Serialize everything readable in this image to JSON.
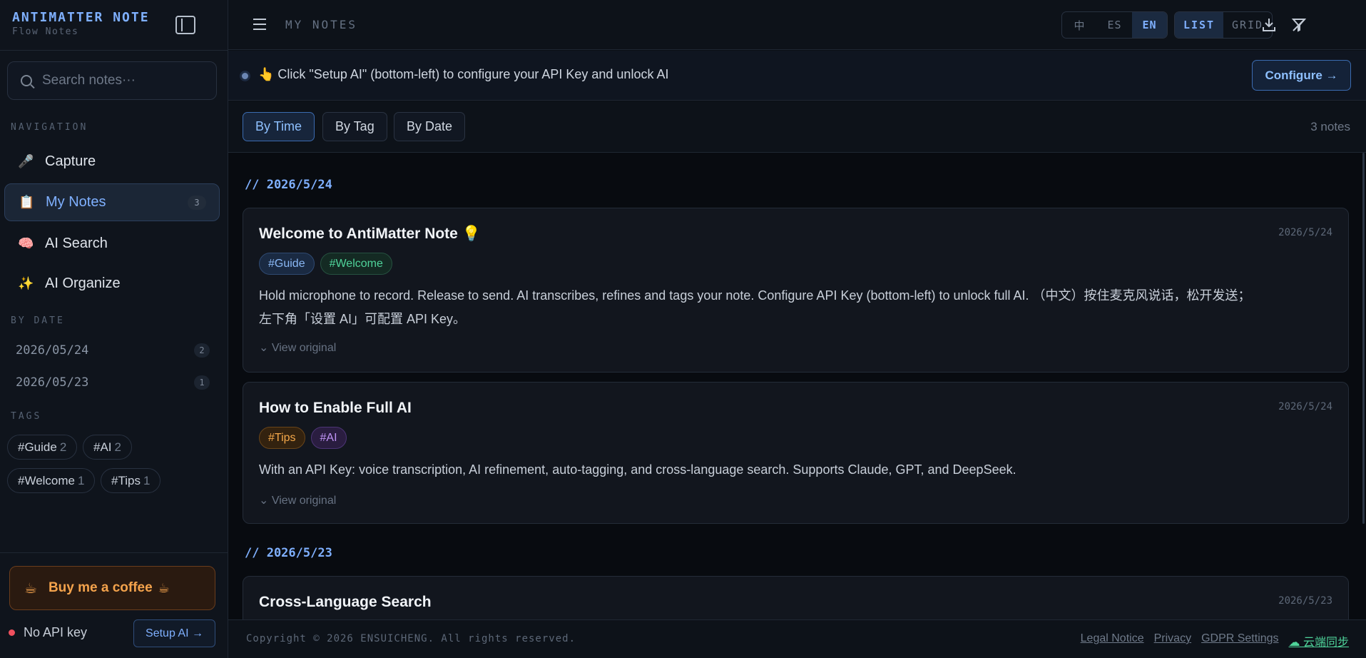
{
  "brand": {
    "title": "ANTIMATTER NOTE",
    "subtitle": "Flow Notes"
  },
  "search": {
    "placeholder": "Search notes···"
  },
  "sidebar": {
    "nav_label": "NAVIGATION",
    "nav": [
      {
        "label": "Capture",
        "icon": "🎤"
      },
      {
        "label": "My Notes",
        "icon": "📋",
        "count": "3"
      },
      {
        "label": "AI Search",
        "icon": "🧠"
      },
      {
        "label": "AI Organize",
        "icon": "✨"
      }
    ],
    "date_label": "BY DATE",
    "dates": [
      {
        "label": "2026/05/24",
        "count": "2"
      },
      {
        "label": "2026/05/23",
        "count": "1"
      }
    ],
    "tags_label": "TAGS",
    "tags": [
      {
        "label": "#Guide",
        "count": "2"
      },
      {
        "label": "#AI",
        "count": "2"
      },
      {
        "label": "#Welcome",
        "count": "1"
      },
      {
        "label": "#Tips",
        "count": "1"
      }
    ],
    "coffee": {
      "label": "Buy me a coffee",
      "icon": "☕"
    },
    "api_status": "No API key",
    "setup_label": "Setup AI →"
  },
  "topbar": {
    "title": "MY NOTES",
    "languages": [
      "中",
      "ES",
      "EN"
    ],
    "active_language": "EN",
    "views": [
      "LIST",
      "GRID"
    ],
    "active_view": "LIST"
  },
  "banner": {
    "text": "👆 Click \"Setup AI\" (bottom-left) to configure your API Key and unlock AI",
    "button": "Configure →"
  },
  "filters": {
    "sort": [
      "By Time",
      "By Tag",
      "By Date"
    ],
    "active": "By Time",
    "count": "3 notes"
  },
  "groups": [
    {
      "heading": "// 2026/5/24"
    },
    {
      "heading": "// 2026/5/23"
    }
  ],
  "notes": [
    {
      "title": "Welcome to AntiMatter Note 💡",
      "date": "2026/5/24",
      "tags": [
        "#Guide",
        "#Welcome"
      ],
      "body_line1": "Hold microphone to record. Release to send. AI transcribes, refines and tags your note. Configure API Key (bottom-left) to unlock full AI. （中文）按住麦克风说话，松开发送；",
      "body_line2": "左下角「设置 AI」可配置 API Key。",
      "view_original": "View original"
    },
    {
      "title": "How to Enable Full AI",
      "date": "2026/5/24",
      "tags": [
        "#Tips",
        "#AI"
      ],
      "body_line1": "With an API Key: voice transcription, AI refinement, auto-tagging, and cross-language search. Supports Claude, GPT, and DeepSeek.",
      "view_original": "View original"
    },
    {
      "title": "Cross-Language Search",
      "date": "2026/5/23"
    }
  ],
  "footer": {
    "copyright": "Copyright © 2026 ENSUICHENG. All rights reserved.",
    "links": [
      "Legal Notice",
      "Privacy",
      "GDPR Settings",
      "☁ 云端同步"
    ]
  },
  "colors": {
    "accent": "#7fb0ff",
    "background": "#0b0f15",
    "status_error": "#f0505e",
    "sync_green": "#4fd39a",
    "coffee_orange": "#f4a34c"
  }
}
